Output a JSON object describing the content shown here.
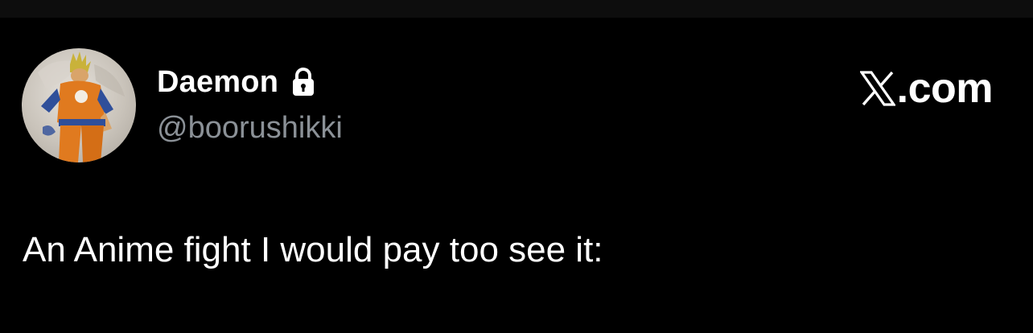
{
  "author": {
    "display_name": "Daemon",
    "handle": "@boorushikki",
    "protected_icon": "lock-icon",
    "avatar": "avatar-image"
  },
  "brand": {
    "logo_icon": "x-logo-icon",
    "label": ".com"
  },
  "tweet": {
    "text": "An Anime fight I would pay too see it:"
  },
  "colors": {
    "background": "#000000",
    "primary_text": "#ffffff",
    "secondary_text": "#8b9197"
  }
}
